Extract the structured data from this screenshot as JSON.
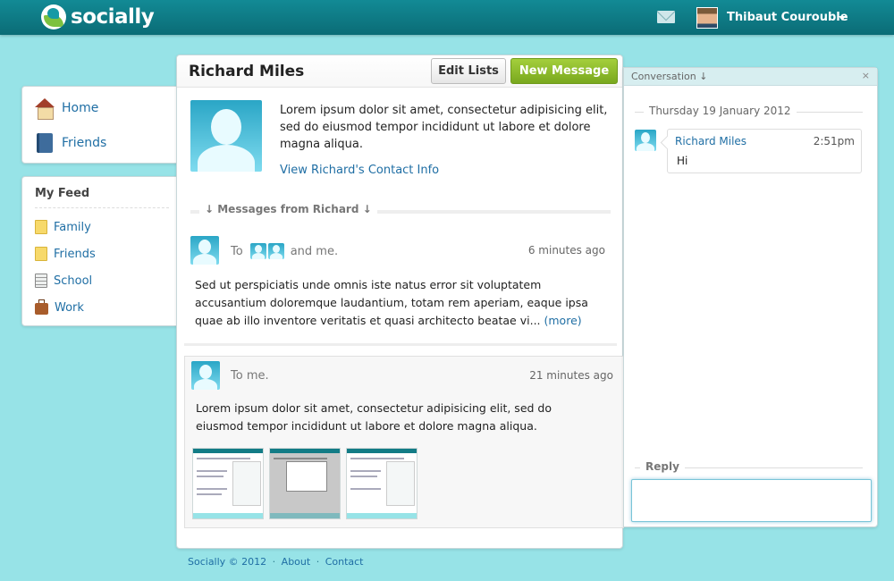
{
  "header": {
    "logo_text": "socially",
    "user_name": "Thibaut Courouble"
  },
  "sidebar": {
    "nav": [
      {
        "label": "Home",
        "icon": "home-icon"
      },
      {
        "label": "Friends",
        "icon": "address-book-icon"
      }
    ],
    "feed_title": "My Feed",
    "feed_items": [
      {
        "label": "Family",
        "icon": "folder-icon"
      },
      {
        "label": "Friends",
        "icon": "folder-icon"
      },
      {
        "label": "School",
        "icon": "notebook-icon"
      },
      {
        "label": "Work",
        "icon": "briefcase-icon"
      }
    ]
  },
  "main": {
    "title": "Richard Miles",
    "edit_lists_label": "Edit Lists",
    "new_message_label": "New Message",
    "bio": "Lorem ipsum dolor sit amet, consectetur adipisicing elit, sed do eiusmod tempor incididunt ut labore et dolore magna aliqua.",
    "contact_link": "View Richard's Contact Info",
    "messages_section": "↓ Messages from Richard ↓",
    "messages": [
      {
        "to_prefix": "To",
        "to_suffix": "and me.",
        "time": "6 minutes ago",
        "body": "Sed ut perspiciatis unde omnis iste natus error sit voluptatem accusantium doloremque laudantium, totam rem aperiam, eaque ipsa quae ab illo inventore veritatis et quasi architecto beatae vi...",
        "more": "(more)"
      },
      {
        "to_prefix": "To me.",
        "time": "21 minutes ago",
        "body": "Lorem ipsum dolor sit amet, consectetur adipisicing elit, sed do eiusmod tempor incididunt ut labore et dolore magna aliqua."
      }
    ]
  },
  "conversation": {
    "title": "Conversation ↓",
    "close": "×",
    "date": "Thursday 19 January 2012",
    "chat": {
      "name": "Richard Miles",
      "time": "2:51pm",
      "text": "Hi"
    },
    "reply_label": "Reply"
  },
  "footer": {
    "copyright": "Socially © 2012",
    "about": "About",
    "contact": "Contact",
    "separator": "·"
  },
  "colors": {
    "background": "#97e3e7",
    "topbar": "#0b6c76",
    "link": "#1f6ea4",
    "accent_green": "#8cbc2a"
  }
}
